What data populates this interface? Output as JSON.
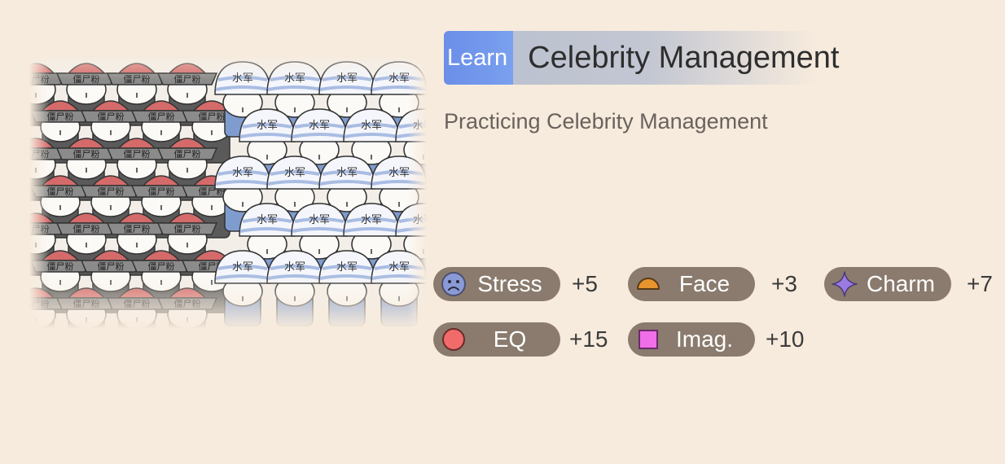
{
  "header": {
    "tag": "Learn",
    "title": "Celebrity Management"
  },
  "description": "Practicing Celebrity Management",
  "illustration": {
    "alt_label_a": "僵尸粉",
    "alt_label_b": "水军"
  },
  "stats": [
    {
      "id": "stress",
      "label": "Stress",
      "value": "+5",
      "icon": "sad-face-icon",
      "color": "#8a9ad6"
    },
    {
      "id": "face",
      "label": "Face",
      "value": "+3",
      "icon": "half-circle-icon",
      "color": "#e8952e"
    },
    {
      "id": "charm",
      "label": "Charm",
      "value": "+7",
      "icon": "sparkle-star-icon",
      "color": "#9b7be0"
    },
    {
      "id": "eq",
      "label": "EQ",
      "value": "+15",
      "icon": "red-circle-icon",
      "color": "#f26b6b"
    },
    {
      "id": "imag",
      "label": "Imag.",
      "value": "+10",
      "icon": "pink-square-icon",
      "color": "#f06ee8"
    }
  ],
  "colors": {
    "background": "#f7ebdd",
    "learn_tag": "#6b8ee8",
    "pill": "#8a7b6e"
  }
}
